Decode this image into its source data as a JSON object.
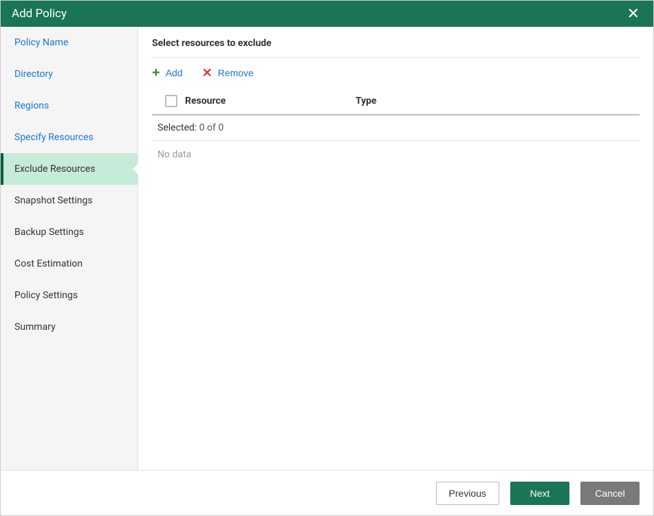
{
  "dialog": {
    "title": "Add Policy"
  },
  "sidebar": {
    "items": [
      {
        "label": "Policy Name",
        "state": "completed"
      },
      {
        "label": "Directory",
        "state": "completed"
      },
      {
        "label": "Regions",
        "state": "completed"
      },
      {
        "label": "Specify Resources",
        "state": "completed"
      },
      {
        "label": "Exclude Resources",
        "state": "active"
      },
      {
        "label": "Snapshot Settings",
        "state": "upcoming"
      },
      {
        "label": "Backup Settings",
        "state": "upcoming"
      },
      {
        "label": "Cost Estimation",
        "state": "upcoming"
      },
      {
        "label": "Policy Settings",
        "state": "upcoming"
      },
      {
        "label": "Summary",
        "state": "upcoming"
      }
    ]
  },
  "main": {
    "page_title": "Select resources to exclude",
    "toolbar": {
      "add_label": "Add",
      "remove_label": "Remove"
    },
    "table": {
      "columns": {
        "resource": "Resource",
        "type": "Type"
      },
      "selected_label": "Selected:",
      "selected_value": "0 of 0",
      "no_data": "No data",
      "rows": []
    }
  },
  "footer": {
    "previous": "Previous",
    "next": "Next",
    "cancel": "Cancel"
  }
}
